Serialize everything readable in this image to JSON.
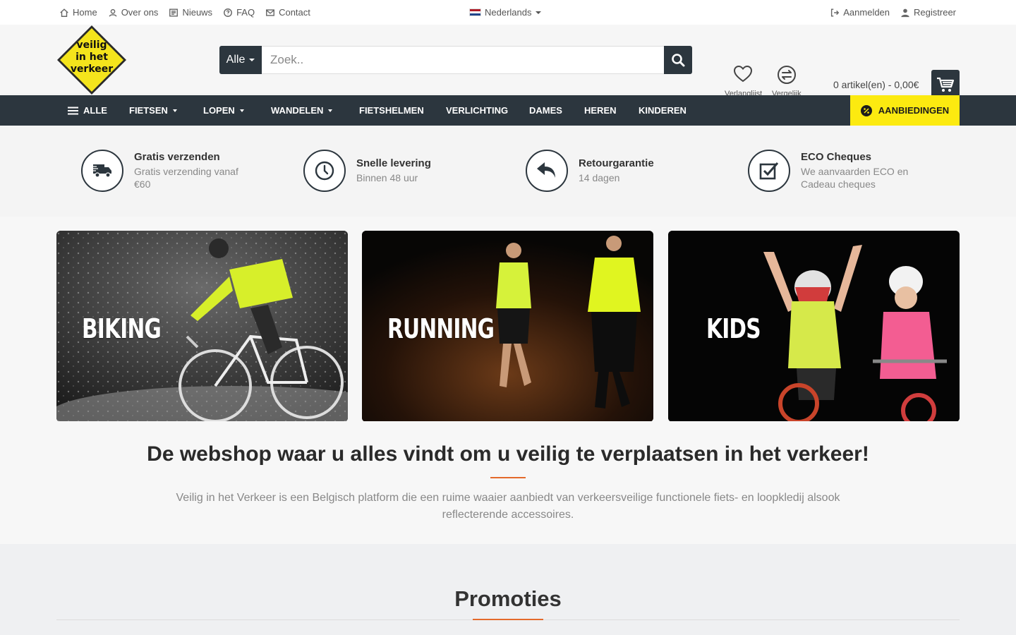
{
  "topbar": {
    "links": [
      {
        "label": "Home",
        "icon": "home-icon"
      },
      {
        "label": "Over ons",
        "icon": "user-circle-icon"
      },
      {
        "label": "Nieuws",
        "icon": "news-icon"
      },
      {
        "label": "FAQ",
        "icon": "question-icon"
      },
      {
        "label": "Contact",
        "icon": "mail-icon"
      }
    ],
    "language": "Nederlands",
    "login": "Aanmelden",
    "register": "Registreer"
  },
  "header": {
    "logo_text": [
      "veilig",
      "in het",
      "verkeer"
    ],
    "search": {
      "category": "Alle",
      "placeholder": "Zoek.."
    },
    "wishlist": "Verlanglijst",
    "compare": "Vergelijk",
    "cart": "0 artikel(en) - 0,00€"
  },
  "nav": {
    "all": "ALLE",
    "items": [
      "FIETSEN",
      "LOPEN",
      "WANDELEN",
      "FIETSHELMEN",
      "VERLICHTING",
      "DAMES",
      "HEREN",
      "KINDEREN"
    ],
    "promo": "AANBIEDINGEN"
  },
  "usps": [
    {
      "title": "Gratis verzenden",
      "text": "Gratis verzending vanaf €60",
      "icon": "truck-icon"
    },
    {
      "title": "Snelle levering",
      "text": "Binnen 48 uur",
      "icon": "clock-icon"
    },
    {
      "title": "Retourgarantie",
      "text": "14 dagen",
      "icon": "return-arrow-icon"
    },
    {
      "title": "ECO Cheques",
      "text": "We aanvaarden ECO en Cadeau cheques",
      "icon": "checkbox-icon"
    }
  ],
  "banners": [
    {
      "label": "BIKING"
    },
    {
      "label": "RUNNING"
    },
    {
      "label": "KIDS"
    }
  ],
  "intro": {
    "title": "De webshop waar u alles vindt om u veilig te verplaatsen in het verkeer!",
    "text": "Veilig in het Verkeer is een Belgisch platform die een ruime waaier aanbiedt van verkeersveilige functionele fiets- en loopkledij alsook reflecterende accessoires."
  },
  "promotions": {
    "title": "Promoties"
  },
  "colors": {
    "dark": "#2c363e",
    "accent_yellow": "#fcea10",
    "accent_orange": "#e46a2b"
  }
}
